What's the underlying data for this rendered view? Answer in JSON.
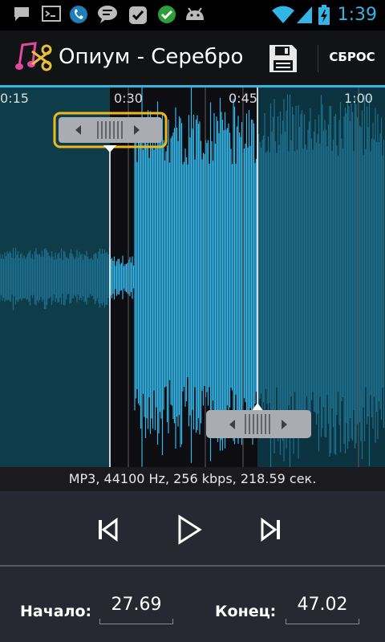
{
  "status_bar": {
    "time": "1:39",
    "icons": [
      "chat-bubble-icon",
      "terminal-icon",
      "phone-icon",
      "message-icon",
      "checkbox-icon",
      "check-circle-icon",
      "android-icon",
      "wifi-icon",
      "signal-icon",
      "battery-charging-icon"
    ],
    "accent_color": "#33b5e5"
  },
  "action_bar": {
    "title": "Опиум - Серебро",
    "reset_label": "СБРОС",
    "logo_icon": "music-scissors-icon",
    "save_icon": "floppy-disk-icon"
  },
  "timeline": {
    "labels": [
      "0:15",
      "0:30",
      "0:45",
      "1:00"
    ]
  },
  "waveform": {
    "selection_start_sec": 27.69,
    "selection_end_sec": 47.02,
    "selected_color": "#33b5e5",
    "unselected_color": "#1e6f8e"
  },
  "info": {
    "text": "MP3, 44100 Hz, 256 kbps, 218.59 сек."
  },
  "controls": {
    "prev_icon": "skip-previous-icon",
    "play_icon": "play-icon",
    "next_icon": "skip-next-icon"
  },
  "fields": {
    "start_label": "Начало:",
    "start_value": "27.69",
    "end_label": "Конец:",
    "end_value": "47.02"
  }
}
